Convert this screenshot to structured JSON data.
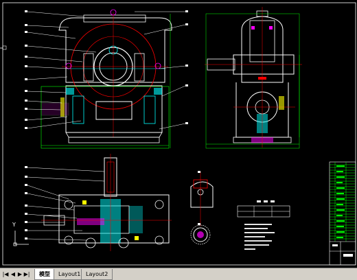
{
  "colors": {
    "background": "#000000",
    "white": "#ffffff",
    "green": "#00ff00",
    "red": "#ff0000",
    "cyan": "#00ffff",
    "magenta": "#ff00ff",
    "yellow": "#ffff00",
    "tabbar": "#d4d0c8"
  },
  "axis_icon": {
    "label": "Y"
  },
  "tabs": [
    {
      "label": "模型",
      "active": true
    },
    {
      "label": "Layout1",
      "active": false
    },
    {
      "label": "Layout2",
      "active": false
    }
  ],
  "nav": [
    "first-tab-icon",
    "prev-tab-icon",
    "next-tab-icon",
    "last-tab-icon"
  ]
}
